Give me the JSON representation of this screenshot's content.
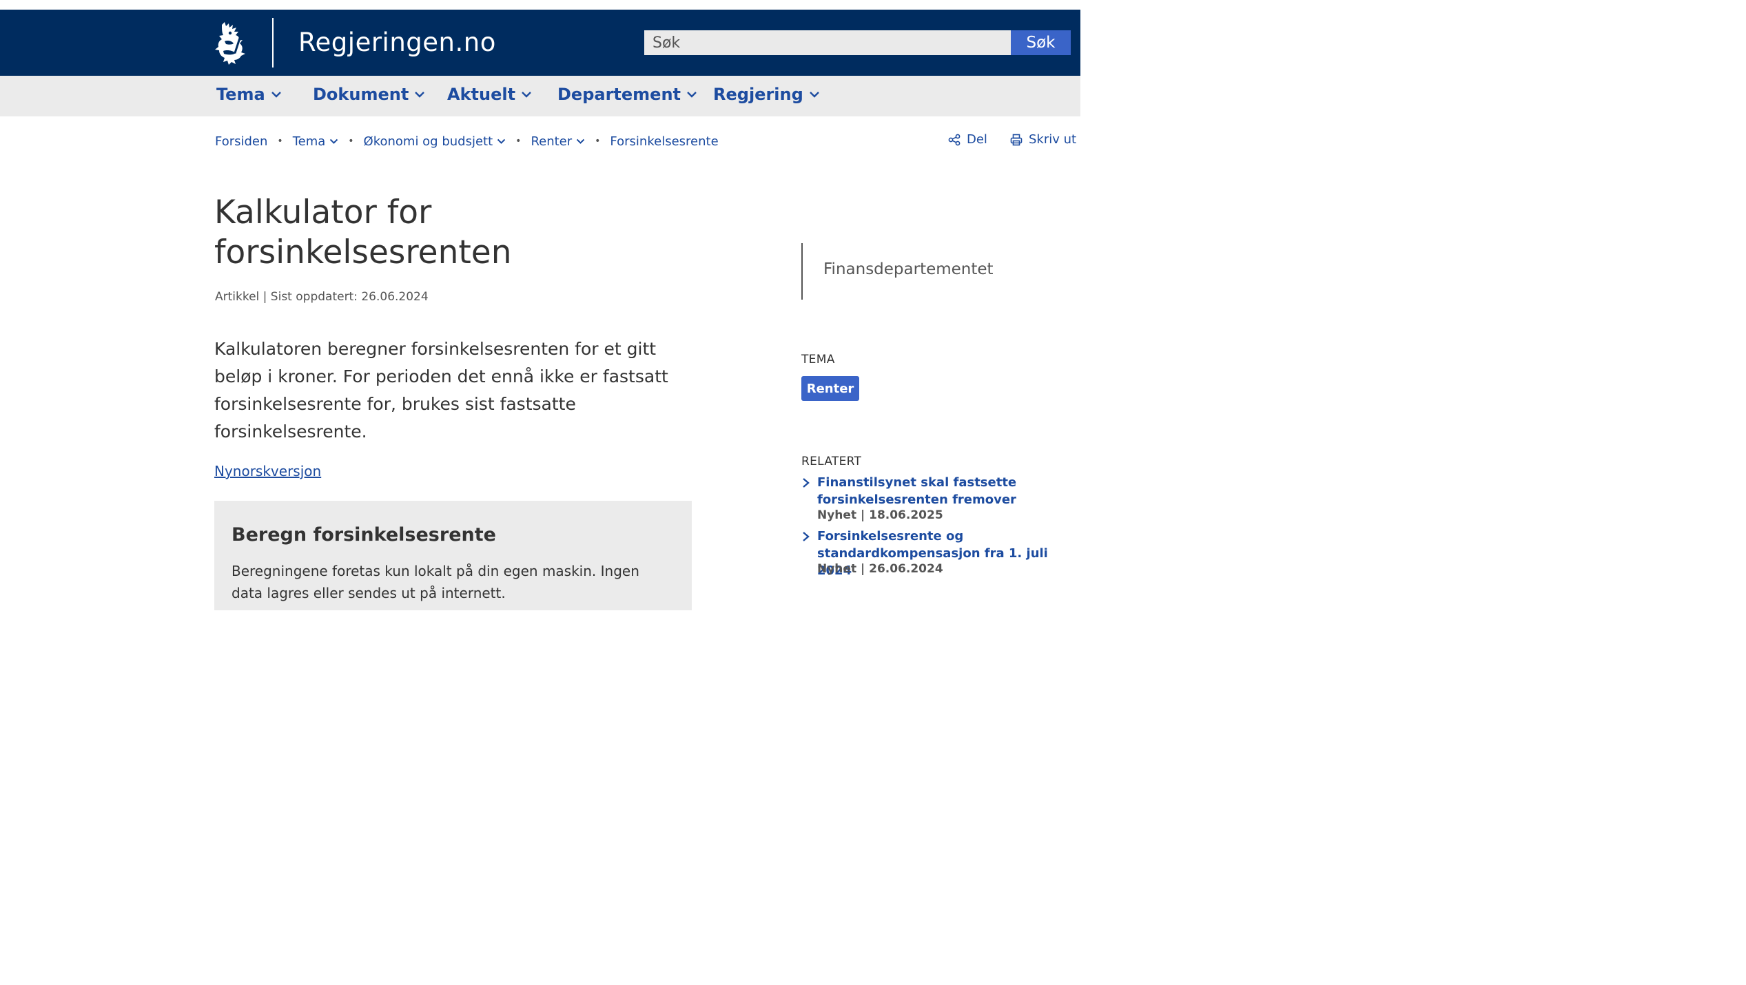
{
  "header": {
    "site_name": "Regjeringen.no",
    "search_placeholder": "Søk",
    "search_button": "Søk",
    "colors": {
      "header_bg": "#002c5f",
      "accent": "#3a64c8",
      "link": "#1d4ca0"
    }
  },
  "nav": {
    "items": [
      {
        "label": "Tema",
        "icon": "chevron-down-icon"
      },
      {
        "label": "Dokument",
        "icon": "chevron-down-icon"
      },
      {
        "label": "Aktuelt",
        "icon": "chevron-down-icon"
      },
      {
        "label": "Departement",
        "icon": "chevron-down-icon"
      },
      {
        "label": "Regjering",
        "icon": "chevron-down-icon"
      }
    ]
  },
  "breadcrumb": {
    "items": [
      {
        "label": "Forsiden"
      },
      {
        "label": "Tema",
        "dropdown": true
      },
      {
        "label": "Økonomi og budsjett",
        "dropdown": true
      },
      {
        "label": "Renter",
        "dropdown": true
      },
      {
        "label": "Forsinkelsesrente"
      }
    ]
  },
  "utils": {
    "share": {
      "label": "Del",
      "icon": "share-icon"
    },
    "print": {
      "label": "Skriv ut",
      "icon": "printer-icon"
    }
  },
  "article": {
    "title": "Kalkulator for forsinkelsesrenten",
    "meta": "Artikkel | Sist oppdatert: 26.06.2024",
    "ingress": "Kalkulatoren beregner forsinkelsesrenten for et gitt beløp i kroner. For perioden det ennå ikke er fastsatt forsinkelsesrente for, brukes sist fastsatte forsinkelsesrente.",
    "language_link": "Nynorskversjon"
  },
  "calculator": {
    "title": "Beregn forsinkelsesrente",
    "description": "Beregningene foretas kun lokalt på din egen maskin. Ingen data lagres eller sendes ut på internett."
  },
  "aside": {
    "department": "Finansdepartementet",
    "tema_heading": "TEMA",
    "tema_tag": "Renter",
    "related_heading": "RELATERT",
    "related": [
      {
        "title": "Finanstilsynet skal fastsette forsinkelsesrenten fremover",
        "meta": "Nyhet | 18.06.2025"
      },
      {
        "title": "Forsinkelsesrente og standardkompensasjon fra 1. juli 2024",
        "meta": "Nyhet | 26.06.2024"
      }
    ]
  }
}
